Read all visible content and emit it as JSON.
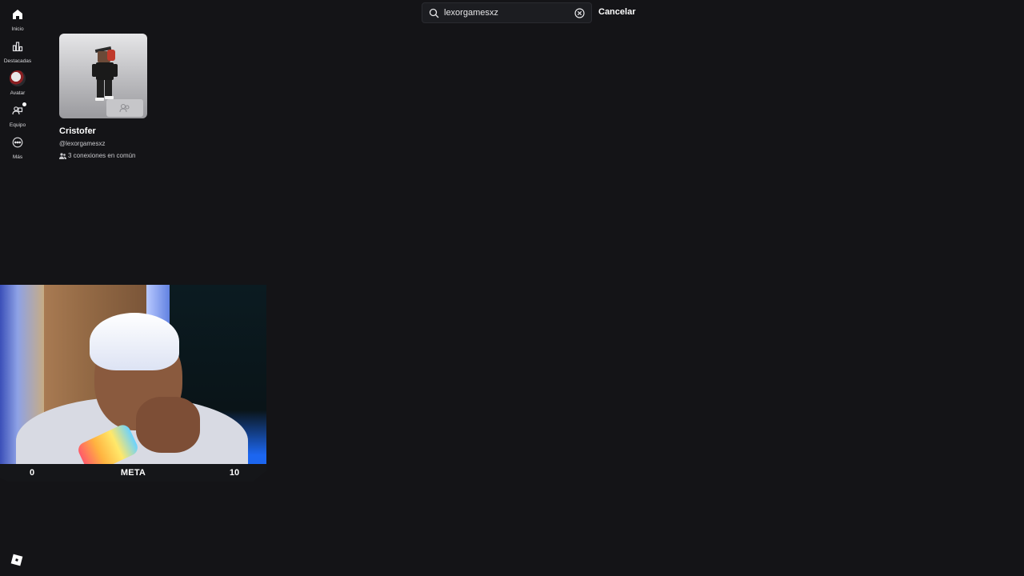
{
  "sidebar": {
    "items": [
      {
        "label": "Inicio",
        "icon": "home-icon"
      },
      {
        "label": "Destacadas",
        "icon": "chart-icon"
      },
      {
        "label": "Avatar",
        "icon": "avatar-icon"
      },
      {
        "label": "Equipo",
        "icon": "team-icon"
      },
      {
        "label": "Más",
        "icon": "more-icon"
      }
    ],
    "logo_icon": "roblox-logo-icon"
  },
  "search": {
    "value": "lexorgamesxz",
    "placeholder": "Buscar",
    "cancel_label": "Cancelar"
  },
  "results": [
    {
      "name": "Cristofer",
      "handle": "@lexorgamesxz",
      "mutual": "3 conexiones en común"
    }
  ],
  "overlay": {
    "meta_start": "0",
    "meta_label": "META",
    "meta_end": "10"
  },
  "colors": {
    "background": "#141417",
    "text": "#ffffff",
    "muted": "#c8c8cc"
  }
}
